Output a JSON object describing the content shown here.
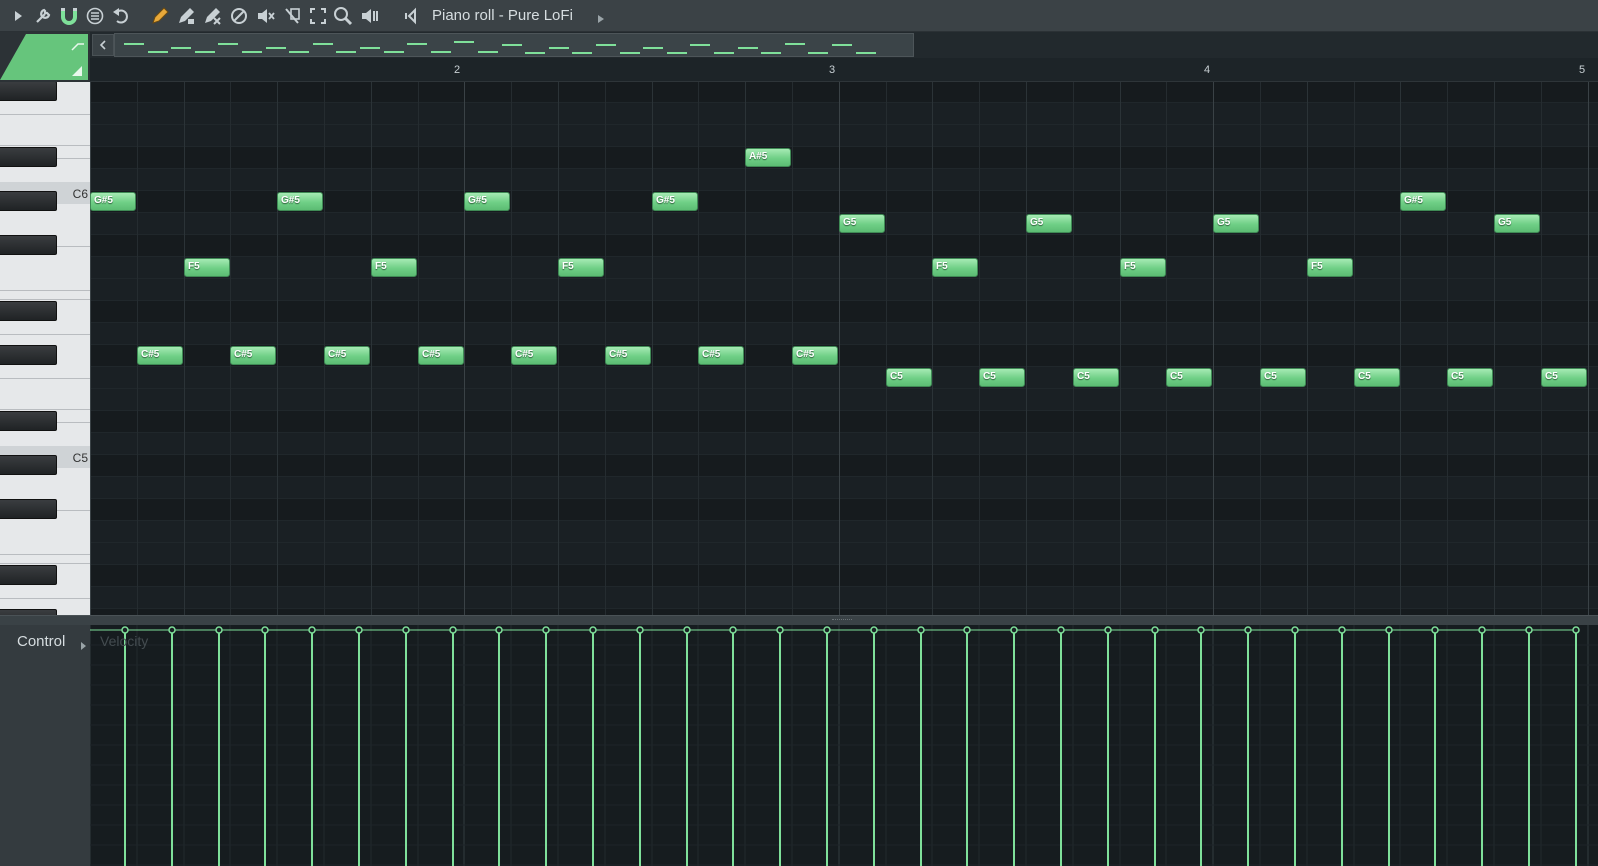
{
  "window": {
    "title": "Piano roll - Pure LoFi"
  },
  "toolbar": {
    "icons": [
      "play-arrow-icon",
      "wrench-icon",
      "magnet-icon",
      "menu-circle-icon",
      "undo-icon",
      "pencil-icon",
      "paint-brush-icon",
      "delete-brush-icon",
      "mute-circle-icon",
      "speaker-mute-icon",
      "slice-icon",
      "select-icon",
      "zoom-icon",
      "playback-icon",
      "speaker-icon"
    ]
  },
  "keyboard": {
    "c_labels": [
      "C6",
      "C5"
    ]
  },
  "ruler": {
    "bars": [
      "2",
      "3",
      "4",
      "5"
    ]
  },
  "notes": [
    {
      "label": "G#5"
    },
    {
      "label": "C#5"
    },
    {
      "label": "F5"
    },
    {
      "label": "C#5"
    },
    {
      "label": "G#5"
    },
    {
      "label": "C#5"
    },
    {
      "label": "F5"
    },
    {
      "label": "C#5"
    },
    {
      "label": "G#5"
    },
    {
      "label": "C#5"
    },
    {
      "label": "F5"
    },
    {
      "label": "C#5"
    },
    {
      "label": "G#5"
    },
    {
      "label": "C#5"
    },
    {
      "label": "A#5"
    },
    {
      "label": "C#5"
    },
    {
      "label": "G5"
    },
    {
      "label": "C5"
    },
    {
      "label": "F5"
    },
    {
      "label": "C5"
    },
    {
      "label": "G5"
    },
    {
      "label": "C5"
    },
    {
      "label": "F5"
    },
    {
      "label": "C5"
    },
    {
      "label": "G5"
    },
    {
      "label": "C5"
    },
    {
      "label": "F5"
    },
    {
      "label": "C5"
    },
    {
      "label": "G#5"
    },
    {
      "label": "C5"
    },
    {
      "label": "G5"
    },
    {
      "label": "C5"
    }
  ],
  "control": {
    "label": "Control",
    "lane_label": "Velocity",
    "velocity_level": 0.8
  },
  "colors": {
    "note": "#6fcf86",
    "velocity": "#7fe09a",
    "background": "#1a2024"
  }
}
